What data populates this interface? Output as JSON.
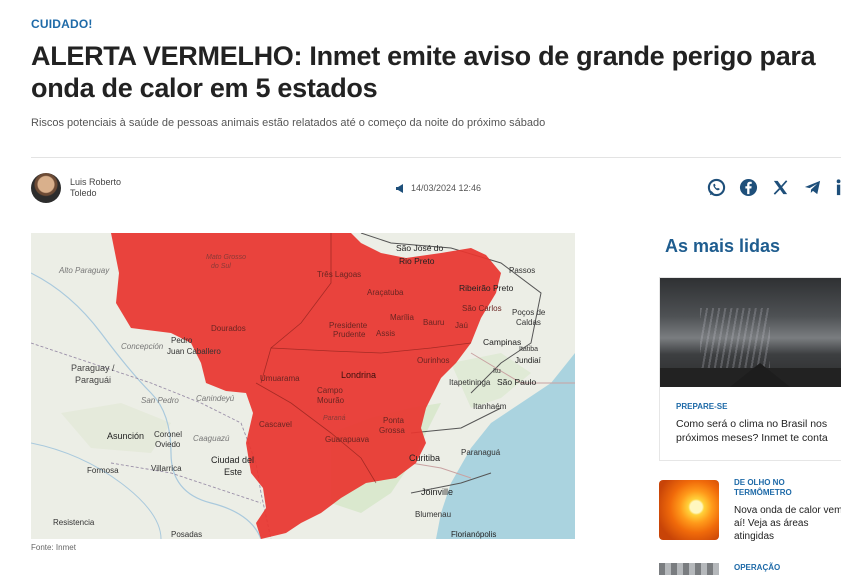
{
  "article": {
    "kicker": "CUIDADO!",
    "headline": "ALERTA VERMELHO: Inmet emite aviso de grande perigo para onda de calor em 5 estados",
    "subtitle": "Riscos potenciais à saúde de pessoas animais estão relatados até o começo da noite do próximo sábado",
    "author_line1": "Luis Roberto",
    "author_line2": "Toledo",
    "date": "14/03/2024 12:46",
    "caption": "Fonte: Inmet"
  },
  "share_icons": [
    "whatsapp-icon",
    "facebook-icon",
    "x-icon",
    "telegram-icon",
    "linkedin-icon"
  ],
  "map": {
    "places": [
      "Mato Grosso do Sul",
      "Alto Paraguay",
      "Três Lagoas",
      "São José do Rio Preto",
      "Passos",
      "Araçatuba",
      "Ribeirão Preto",
      "Dourados",
      "Presidente Prudente",
      "Marília",
      "Bauru",
      "Assis",
      "Jaú",
      "São Carlos",
      "Poços de Caldas",
      "Campinas",
      "Jundiaí",
      "Concepción",
      "Pedro Juan Caballero",
      "Paraguay / Paraguái",
      "Umuarama",
      "Londrina",
      "Ourinhos",
      "Itapetininga",
      "São Paulo",
      "San Pedro",
      "Canindeyú",
      "Campo Mourão",
      "Itanhaém",
      "Asunción",
      "Coronel Oviedo",
      "Caaguazú",
      "Cascavel",
      "Paraná",
      "Ponta Grossa",
      "Guarapuava",
      "Curitiba",
      "Paranaguá",
      "Formosa",
      "Villarrica",
      "Ciudad del Este",
      "Joinville",
      "Blumenau",
      "Resistencia",
      "Posadas",
      "Florianópolis",
      "Itatiba",
      "Itu"
    ]
  },
  "sidebar": {
    "title": "As mais lidas",
    "item1": {
      "category": "PREPARE-SE",
      "title": "Como será o clima no Brasil nos próximos meses? Inmet te conta"
    },
    "item2": {
      "category": "DE OLHO NO TERMÔMETRO",
      "title": "Nova onda de calor vem aí! Veja as áreas atingidas"
    },
    "item3": {
      "category": "OPERAÇÃO"
    }
  },
  "colors": {
    "accent": "#1e6aa8",
    "alert_red": "#e8362f"
  }
}
